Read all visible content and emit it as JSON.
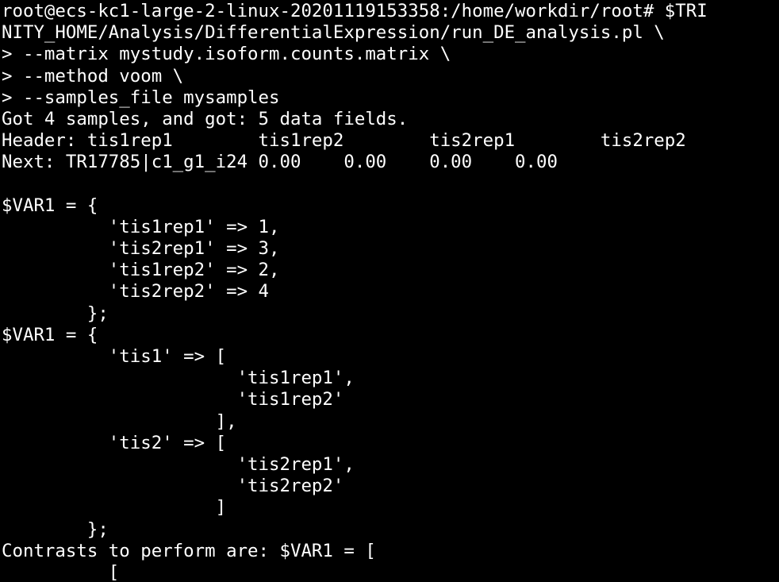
{
  "terminal": {
    "background": "#000000",
    "foreground": "#ffffff",
    "lines": [
      "root@ecs-kc1-large-2-linux-20201119153358:/home/workdir/root# $TRI",
      "NITY_HOME/Analysis/DifferentialExpression/run_DE_analysis.pl \\",
      "> --matrix mystudy.isoform.counts.matrix \\",
      "> --method voom \\",
      "> --samples_file mysamples",
      "Got 4 samples, and got: 5 data fields.",
      "Header: tis1rep1        tis1rep2        tis2rep1        tis2rep2",
      "Next: TR17785|c1_g1_i24 0.00    0.00    0.00    0.00",
      "",
      "$VAR1 = {",
      "          'tis1rep1' => 1,",
      "          'tis2rep1' => 3,",
      "          'tis1rep2' => 2,",
      "          'tis2rep2' => 4",
      "        };",
      "$VAR1 = {",
      "          'tis1' => [",
      "                      'tis1rep1',",
      "                      'tis1rep2'",
      "                    ],",
      "          'tis2' => [",
      "                      'tis2rep1',",
      "                      'tis2rep2'",
      "                    ]",
      "        };",
      "Contrasts to perform are: $VAR1 = [",
      "          ["
    ]
  }
}
